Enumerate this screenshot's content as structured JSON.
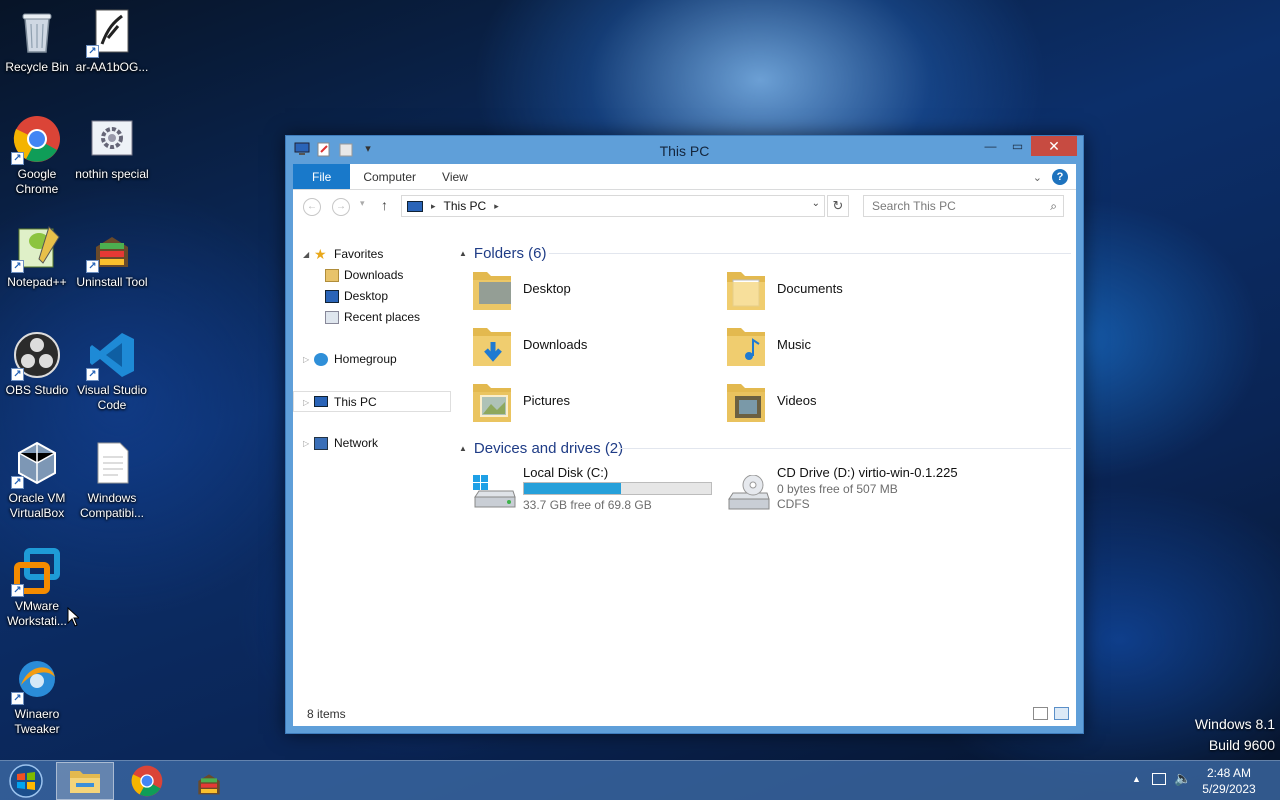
{
  "desktop_icons": [
    {
      "label": "Recycle Bin",
      "icon": "recycle-bin-icon"
    },
    {
      "label": "ar-AA1bOG...",
      "icon": "document-shortcut-icon"
    },
    {
      "label": "Google Chrome",
      "icon": "chrome-icon"
    },
    {
      "label": "nothin special",
      "icon": "settings-app-icon"
    },
    {
      "label": "Notepad++",
      "icon": "notepad-plus-plus-icon"
    },
    {
      "label": "Uninstall Tool",
      "icon": "uninstall-tool-icon"
    },
    {
      "label": "OBS Studio",
      "icon": "obs-icon"
    },
    {
      "label": "Visual Studio Code",
      "icon": "vscode-icon"
    },
    {
      "label": "Oracle VM VirtualBox",
      "icon": "virtualbox-icon"
    },
    {
      "label": "Windows Compatibi...",
      "icon": "text-file-icon"
    },
    {
      "label": "VMware Workstati...",
      "icon": "vmware-icon"
    },
    {
      "label": "Winaero Tweaker",
      "icon": "winaero-icon"
    }
  ],
  "window": {
    "title": "This PC",
    "ribbon_tabs": [
      "File",
      "Computer",
      "View"
    ],
    "address": "This PC",
    "search_placeholder": "Search This PC",
    "status": "8 items"
  },
  "nav_pane": {
    "favorites": "Favorites",
    "favorites_items": [
      "Downloads",
      "Desktop",
      "Recent places"
    ],
    "homegroup": "Homegroup",
    "this_pc": "This PC",
    "network": "Network"
  },
  "folders_group": "Folders (6)",
  "folders": [
    {
      "name": "Desktop",
      "icon": "desktop-folder-icon"
    },
    {
      "name": "Documents",
      "icon": "documents-folder-icon"
    },
    {
      "name": "Downloads",
      "icon": "downloads-folder-icon"
    },
    {
      "name": "Music",
      "icon": "music-folder-icon"
    },
    {
      "name": "Pictures",
      "icon": "pictures-folder-icon"
    },
    {
      "name": "Videos",
      "icon": "videos-folder-icon"
    }
  ],
  "drives_group": "Devices and drives (2)",
  "drives": [
    {
      "name": "Local Disk (C:)",
      "detail": "33.7 GB free of 69.8 GB",
      "used_fraction": 0.517,
      "icon": "local-disk-icon"
    },
    {
      "name": "CD Drive (D:) virtio-win-0.1.225",
      "detail": "0 bytes free of 507 MB",
      "filesystem": "CDFS",
      "icon": "cd-drive-icon"
    }
  ],
  "taskbar": {
    "time": "2:48 AM",
    "date": "5/29/2023"
  },
  "watermark": {
    "line1": "Windows 8.1",
    "line2": "Build 9600"
  },
  "colors": {
    "accent": "#1979ca",
    "title_bar": "#5f9fd9",
    "close_button": "#c74b41",
    "group_header": "#1f3c86",
    "drive_bar": "#26a0da"
  }
}
